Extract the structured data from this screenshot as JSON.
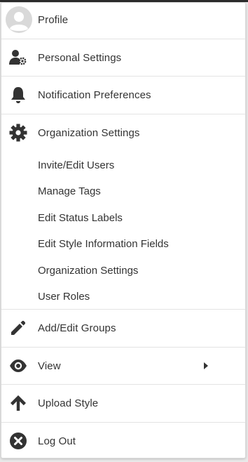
{
  "menu": {
    "profile": {
      "label": "Profile",
      "icon": "avatar-icon"
    },
    "personal_settings": {
      "label": "Personal Settings",
      "icon": "user-gear-icon"
    },
    "notification_preferences": {
      "label": "Notification Preferences",
      "icon": "bell-icon"
    },
    "organization_settings": {
      "label": "Organization Settings",
      "icon": "gear-icon",
      "items": [
        {
          "label": "Invite/Edit Users"
        },
        {
          "label": "Manage Tags"
        },
        {
          "label": "Edit Status Labels"
        },
        {
          "label": "Edit Style Information Fields"
        },
        {
          "label": "Organization Settings"
        },
        {
          "label": "User Roles"
        }
      ]
    },
    "add_edit_groups": {
      "label": "Add/Edit Groups",
      "icon": "pencil-icon"
    },
    "view": {
      "label": "View",
      "icon": "eye-icon",
      "submenu_icon": "caret-right-icon"
    },
    "upload_style": {
      "label": "Upload Style",
      "icon": "arrow-up-icon"
    },
    "log_out": {
      "label": "Log Out",
      "icon": "x-circle-icon"
    }
  },
  "colors": {
    "text": "#333333",
    "icon": "#333333",
    "avatar_bg": "#d9d9d9",
    "divider": "#e3e3e3"
  }
}
